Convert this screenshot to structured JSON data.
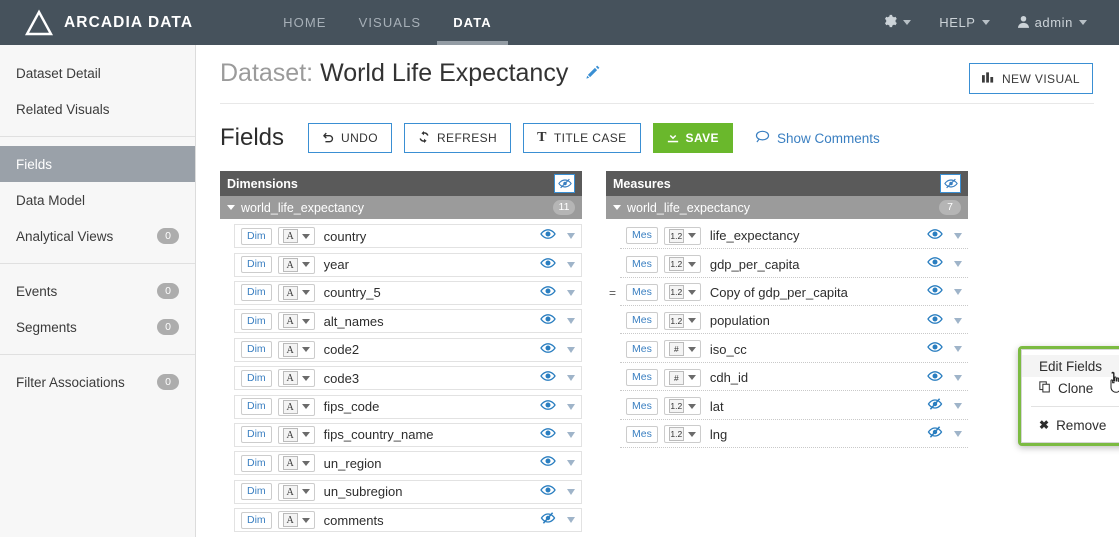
{
  "topnav": {
    "brand": "ARCADIA DATA",
    "logo_icon": "triangle-logo-icon",
    "tabs": [
      {
        "label": "HOME",
        "active": false
      },
      {
        "label": "VISUALS",
        "active": false
      },
      {
        "label": "DATA",
        "active": true
      }
    ],
    "right": {
      "settings_icon": "gear-icon",
      "help_label": "HELP",
      "user_icon": "person-icon",
      "user_label": "admin"
    }
  },
  "sidebar": {
    "items": [
      {
        "label": "Dataset Detail",
        "badge": "",
        "active": false
      },
      {
        "label": "Related Visuals",
        "badge": "",
        "active": false
      },
      {
        "label": "Fields",
        "badge": "",
        "active": true
      },
      {
        "label": "Data Model",
        "badge": "",
        "active": false
      },
      {
        "label": "Analytical Views",
        "badge": "0",
        "active": false
      },
      {
        "label": "Events",
        "badge": "0",
        "active": false
      },
      {
        "label": "Segments",
        "badge": "0",
        "active": false
      },
      {
        "label": "Filter Associations",
        "badge": "0",
        "active": false
      }
    ]
  },
  "page": {
    "title_prefix": "Dataset:",
    "title_name": "World Life Expectancy",
    "edit_icon": "pencil-icon",
    "new_visual": {
      "label": "NEW VISUAL",
      "icon": "bar-chart-icon"
    }
  },
  "toolbar": {
    "heading": "Fields",
    "undo_label": "UNDO",
    "refresh_label": "REFRESH",
    "title_case_label": "TITLE CASE",
    "save_label": "SAVE",
    "show_comments_label": "Show Comments"
  },
  "panels": {
    "dimensions": {
      "header": "Dimensions",
      "visibility_icon": "eye-slash-icon",
      "table_name": "world_life_expectancy",
      "count": "11",
      "rows": [
        {
          "tag": "Dim",
          "type": "A",
          "name": "country",
          "visible": true,
          "calculated": false
        },
        {
          "tag": "Dim",
          "type": "A",
          "name": "year",
          "visible": true,
          "calculated": false
        },
        {
          "tag": "Dim",
          "type": "A",
          "name": "country_5",
          "visible": true,
          "calculated": false
        },
        {
          "tag": "Dim",
          "type": "A",
          "name": "alt_names",
          "visible": true,
          "calculated": false
        },
        {
          "tag": "Dim",
          "type": "A",
          "name": "code2",
          "visible": true,
          "calculated": false
        },
        {
          "tag": "Dim",
          "type": "A",
          "name": "code3",
          "visible": true,
          "calculated": false
        },
        {
          "tag": "Dim",
          "type": "A",
          "name": "fips_code",
          "visible": true,
          "calculated": false
        },
        {
          "tag": "Dim",
          "type": "A",
          "name": "fips_country_name",
          "visible": true,
          "calculated": false
        },
        {
          "tag": "Dim",
          "type": "A",
          "name": "un_region",
          "visible": true,
          "calculated": false
        },
        {
          "tag": "Dim",
          "type": "A",
          "name": "un_subregion",
          "visible": true,
          "calculated": false
        },
        {
          "tag": "Dim",
          "type": "A",
          "name": "comments",
          "visible": false,
          "calculated": false
        }
      ]
    },
    "measures": {
      "header": "Measures",
      "visibility_icon": "eye-slash-icon",
      "table_name": "world_life_expectancy",
      "count": "7",
      "rows": [
        {
          "tag": "Mes",
          "type": "1.2",
          "name": "life_expectancy",
          "visible": true,
          "calculated": false
        },
        {
          "tag": "Mes",
          "type": "1.2",
          "name": "gdp_per_capita",
          "visible": true,
          "calculated": false
        },
        {
          "tag": "Mes",
          "type": "1.2",
          "name": "Copy of gdp_per_capita",
          "visible": true,
          "calculated": true
        },
        {
          "tag": "Mes",
          "type": "1.2",
          "name": "population",
          "visible": true,
          "calculated": false
        },
        {
          "tag": "Mes",
          "type": "#",
          "name": "iso_cc",
          "visible": true,
          "calculated": false
        },
        {
          "tag": "Mes",
          "type": "#",
          "name": "cdh_id",
          "visible": true,
          "calculated": false
        },
        {
          "tag": "Mes",
          "type": "1.2",
          "name": "lat",
          "visible": false,
          "calculated": false
        },
        {
          "tag": "Mes",
          "type": "1.2",
          "name": "lng",
          "visible": false,
          "calculated": false
        }
      ]
    }
  },
  "context_menu": {
    "items": [
      {
        "label": "Edit Fields",
        "icon": "",
        "highlighted": true
      },
      {
        "label": "Clone",
        "icon": "copy-icon",
        "highlighted": false
      },
      {
        "label": "Remove",
        "icon": "x-icon",
        "highlighted": false
      }
    ]
  },
  "colors": {
    "navbar": "#46525c",
    "accent_blue": "#3a8fd3",
    "save_green": "#6ab82c",
    "menu_border_green": "#7cbb42",
    "panel_header": "#5a5a5a",
    "sidebar_active": "#9aa1a9"
  }
}
